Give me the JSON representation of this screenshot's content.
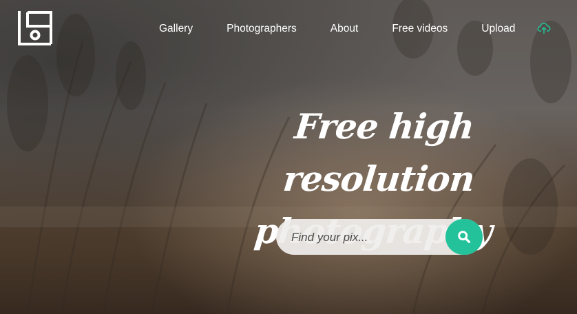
{
  "brand": {
    "logo_icon": "camera-frame-logo-icon"
  },
  "nav": {
    "items": [
      {
        "label": "Gallery"
      },
      {
        "label": "Photographers"
      },
      {
        "label": "About"
      },
      {
        "label": "Free videos"
      },
      {
        "label": "Upload"
      }
    ],
    "upload_icon": "cloud-upload-icon"
  },
  "hero": {
    "headline_line1": "Free high resolution",
    "headline_line2": "photography"
  },
  "search": {
    "placeholder": "Find your pix...",
    "value": "",
    "button_icon": "search-icon"
  },
  "colors": {
    "accent": "#23c29a",
    "text": "#ffffff"
  }
}
